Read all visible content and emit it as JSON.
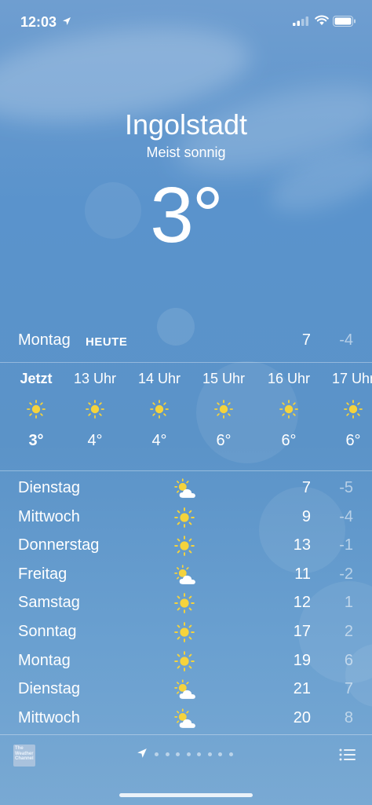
{
  "status_bar": {
    "time": "12:03"
  },
  "location": {
    "city": "Ingolstadt",
    "condition": "Meist sonnig",
    "temperature": "3°"
  },
  "today": {
    "day": "Montag",
    "label": "HEUTE",
    "high": "7",
    "low": "-4"
  },
  "hourly": [
    {
      "time": "Jetzt",
      "icon": "sun-icon",
      "temp": "3°"
    },
    {
      "time": "13 Uhr",
      "icon": "sun-icon",
      "temp": "4°"
    },
    {
      "time": "14 Uhr",
      "icon": "sun-icon",
      "temp": "4°"
    },
    {
      "time": "15 Uhr",
      "icon": "sun-icon",
      "temp": "6°"
    },
    {
      "time": "16 Uhr",
      "icon": "sun-icon",
      "temp": "6°"
    },
    {
      "time": "17 Uhr",
      "icon": "sun-icon",
      "temp": "6°"
    }
  ],
  "daily": [
    {
      "day": "Dienstag",
      "icon": "partly-cloudy-icon",
      "high": "7",
      "low": "-5"
    },
    {
      "day": "Mittwoch",
      "icon": "sun-icon",
      "high": "9",
      "low": "-4"
    },
    {
      "day": "Donnerstag",
      "icon": "sun-icon",
      "high": "13",
      "low": "-1"
    },
    {
      "day": "Freitag",
      "icon": "partly-cloudy-icon",
      "high": "11",
      "low": "-2"
    },
    {
      "day": "Samstag",
      "icon": "sun-icon",
      "high": "12",
      "low": "1"
    },
    {
      "day": "Sonntag",
      "icon": "sun-icon",
      "high": "17",
      "low": "2"
    },
    {
      "day": "Montag",
      "icon": "sun-icon",
      "high": "19",
      "low": "6"
    },
    {
      "day": "Dienstag",
      "icon": "partly-cloudy-icon",
      "high": "21",
      "low": "7"
    },
    {
      "day": "Mittwoch",
      "icon": "partly-cloudy-icon",
      "high": "20",
      "low": "8"
    }
  ],
  "footer": {
    "logo_text": "The Weather Channel",
    "page_count": 9,
    "current_page": 1
  },
  "colors": {
    "sun": "#f5d33c",
    "cloud": "#ffffff"
  }
}
